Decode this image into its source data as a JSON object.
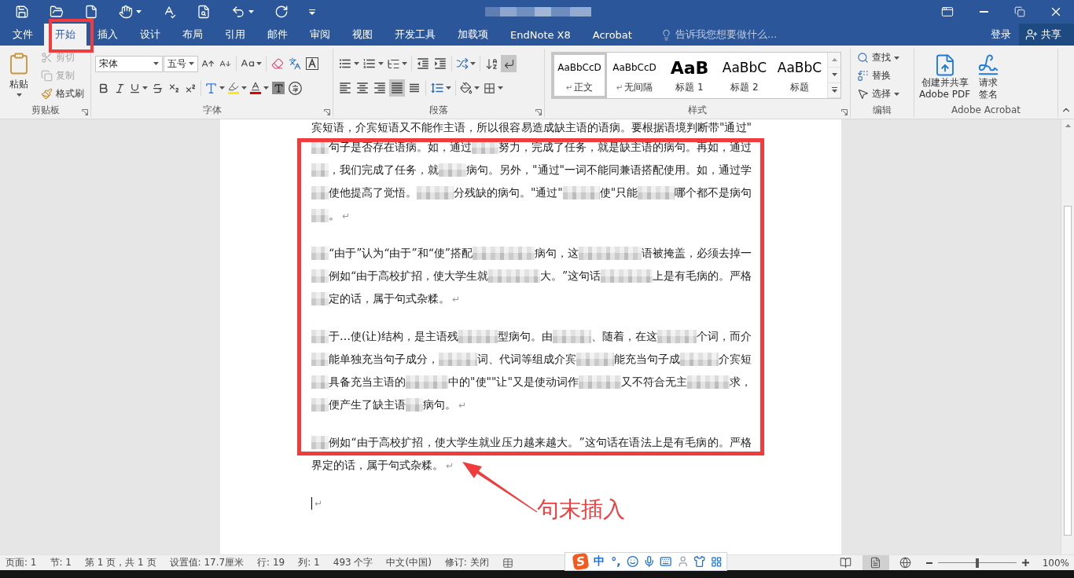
{
  "menu_tabs": [
    {
      "label": "文件",
      "selected": false
    },
    {
      "label": "开始",
      "selected": true
    },
    {
      "label": "插入",
      "selected": false
    },
    {
      "label": "设计",
      "selected": false
    },
    {
      "label": "布局",
      "selected": false
    },
    {
      "label": "引用",
      "selected": false
    },
    {
      "label": "邮件",
      "selected": false
    },
    {
      "label": "审阅",
      "selected": false
    },
    {
      "label": "视图",
      "selected": false
    },
    {
      "label": "开发工具",
      "selected": false
    },
    {
      "label": "加载项",
      "selected": false
    },
    {
      "label": "EndNote X8",
      "selected": false
    },
    {
      "label": "Acrobat",
      "selected": false
    }
  ],
  "tell_me": {
    "placeholder": "告诉我您想要做什么..."
  },
  "account": {
    "sign_in": "登录",
    "share": "共享"
  },
  "ribbon": {
    "clipboard": {
      "label": "剪贴板",
      "paste": "粘贴",
      "actions": [
        {
          "kind": "cut",
          "label": "剪切",
          "disabled": true
        },
        {
          "kind": "copy",
          "label": "复制",
          "disabled": true
        },
        {
          "kind": "format_painter",
          "label": "格式刷",
          "disabled": false
        }
      ]
    },
    "font": {
      "label": "字体",
      "font_name": "宋体",
      "font_size": "五号"
    },
    "paragraph": {
      "label": "段落",
      "show_marks": {
        "on": true
      },
      "alignment": [
        {
          "kind": "left",
          "selected": false
        },
        {
          "kind": "center",
          "selected": false
        },
        {
          "kind": "right",
          "selected": false
        },
        {
          "kind": "justify",
          "selected": true
        },
        {
          "kind": "distributed",
          "selected": false
        }
      ]
    },
    "styles": {
      "label": "样式",
      "items": [
        {
          "kind": "normal",
          "sample": "AaBbCcD",
          "mark": "↵",
          "name": "正文",
          "selected": true
        },
        {
          "kind": "normal",
          "sample": "AaBbCcD",
          "mark": "↵",
          "name": "无间隔",
          "selected": false
        },
        {
          "kind": "heading1",
          "sample": "AaB",
          "name": "标题 1",
          "selected": false
        },
        {
          "kind": "heading2",
          "sample": "AaBbC",
          "name": "标题 2",
          "selected": false
        },
        {
          "kind": "title",
          "sample": "AaBbC",
          "name": "标题",
          "selected": false
        }
      ]
    },
    "editing": {
      "label": "编辑",
      "actions": [
        {
          "kind": "find",
          "label": "查找"
        },
        {
          "kind": "replace",
          "label": "替换"
        },
        {
          "kind": "select",
          "label": "选择"
        }
      ]
    },
    "acrobat": {
      "label": "Adobe Acrobat",
      "actions": [
        {
          "kind": "create_pdf",
          "lines": [
            "创建并共享",
            "Adobe PDF"
          ]
        },
        {
          "kind": "sign",
          "lines": [
            "请求",
            "签名"
          ]
        }
      ]
    }
  },
  "document": {
    "paragraphs": [
      {
        "lines": [
          {
            "segments": [
              {
                "kind": "text",
                "text": "宾短语，介宾短语又不能作主语，所以很容易造成缺主语的语病。要根据语境判断带\"通过\""
              }
            ]
          },
          {
            "segments": [
              {
                "kind": "blur"
              },
              {
                "kind": "text",
                "text": "句子是否存在语病。如，通过"
              },
              {
                "kind": "blur"
              },
              {
                "kind": "text",
                "text": "努力，完成了任务，就是缺主语的病句。再如，通过"
              }
            ]
          },
          {
            "segments": [
              {
                "kind": "blur"
              },
              {
                "kind": "text",
                "text": "，我们完成了任务，就"
              },
              {
                "kind": "blur"
              },
              {
                "kind": "text",
                "text": "病句。另外，\"通过\"一词不能同兼语搭配使用。如，通过学"
              }
            ]
          },
          {
            "segments": [
              {
                "kind": "blur"
              },
              {
                "kind": "text",
                "text": "使他提高了觉悟。"
              },
              {
                "kind": "blur"
              },
              {
                "kind": "text",
                "text": "分残缺的病句。\"通过\""
              },
              {
                "kind": "blur"
              },
              {
                "kind": "text",
                "text": "使\"只能"
              },
              {
                "kind": "blur"
              },
              {
                "kind": "text",
                "text": "哪个都不是病句"
              }
            ]
          },
          {
            "segments": [
              {
                "kind": "blur"
              },
              {
                "kind": "text",
                "text": "。"
              },
              {
                "kind": "mark",
                "text": "↵"
              }
            ]
          }
        ]
      },
      {
        "lines": [
          {
            "segments": [
              {
                "kind": "blur"
              },
              {
                "kind": "text",
                "text": "“由于”认为“由于”和“使”搭配"
              },
              {
                "kind": "blur"
              },
              {
                "kind": "text",
                "text": "病句，这"
              },
              {
                "kind": "blur"
              },
              {
                "kind": "text",
                "text": "语被掩盖，必须去掉一"
              }
            ]
          },
          {
            "segments": [
              {
                "kind": "blur"
              },
              {
                "kind": "text",
                "text": "例如“由于高校扩招，使大学生就"
              },
              {
                "kind": "blur"
              },
              {
                "kind": "text",
                "text": "大。”这句话"
              },
              {
                "kind": "blur"
              },
              {
                "kind": "text",
                "text": "上是有毛病的。严格"
              }
            ]
          },
          {
            "segments": [
              {
                "kind": "blur"
              },
              {
                "kind": "text",
                "text": "定的话，属于句式杂糅。"
              },
              {
                "kind": "mark",
                "text": "↵"
              }
            ]
          }
        ]
      },
      {
        "lines": [
          {
            "segments": [
              {
                "kind": "blur"
              },
              {
                "kind": "text",
                "text": "于…使(让)结构，是主语残"
              },
              {
                "kind": "blur"
              },
              {
                "kind": "text",
                "text": "型病句。由"
              },
              {
                "kind": "blur"
              },
              {
                "kind": "text",
                "text": "、随着，在这"
              },
              {
                "kind": "blur"
              },
              {
                "kind": "text",
                "text": "个词，而介"
              }
            ]
          },
          {
            "segments": [
              {
                "kind": "blur"
              },
              {
                "kind": "text",
                "text": "能单独充当句子成分，"
              },
              {
                "kind": "blur"
              },
              {
                "kind": "text",
                "text": "词、代词等组成介宾"
              },
              {
                "kind": "blur"
              },
              {
                "kind": "text",
                "text": "能充当句子成"
              },
              {
                "kind": "blur"
              },
              {
                "kind": "text",
                "text": "介宾短"
              }
            ]
          },
          {
            "segments": [
              {
                "kind": "blur"
              },
              {
                "kind": "text",
                "text": "具备充当主语的"
              },
              {
                "kind": "blur"
              },
              {
                "kind": "text",
                "text": "中的\"使\"\"让\"又是使动词作"
              },
              {
                "kind": "blur"
              },
              {
                "kind": "text",
                "text": "又不符合无主"
              },
              {
                "kind": "blur"
              },
              {
                "kind": "text",
                "text": "求，"
              }
            ]
          },
          {
            "segments": [
              {
                "kind": "blur"
              },
              {
                "kind": "text",
                "text": "便产生了缺主语"
              },
              {
                "kind": "blur"
              },
              {
                "kind": "text",
                "text": "病句。"
              },
              {
                "kind": "mark",
                "text": "↵"
              }
            ]
          }
        ]
      },
      {
        "lines": [
          {
            "segments": [
              {
                "kind": "blur"
              },
              {
                "kind": "text",
                "text": "例如“由于高校扩招，使大学生就业压力越来越大。”这句话在语法上是有毛病的。严格"
              }
            ]
          },
          {
            "segments": [
              {
                "kind": "text",
                "text": "界定的话，属于句式杂糅。"
              },
              {
                "kind": "mark",
                "text": "↵"
              }
            ]
          }
        ]
      },
      {
        "lines": [
          {
            "segments": [
              {
                "kind": "cursor"
              },
              {
                "kind": "mark",
                "text": "↵"
              }
            ]
          }
        ]
      }
    ]
  },
  "annotation": {
    "label": "句末插入"
  },
  "status_bar": {
    "items": [
      "页面: 1",
      "节: 1",
      "第 1 页，共 1 页",
      "设置值: 17.7厘米",
      "行: 19",
      "列: 1",
      "493 个字",
      "中文(中国)",
      "修订: 关闭"
    ],
    "ime": {
      "logo": "S",
      "mode": "中",
      "punctuation": "°,"
    },
    "views": [
      {
        "kind": "read",
        "selected": false
      },
      {
        "kind": "print",
        "selected": true
      },
      {
        "kind": "web",
        "selected": false
      }
    ],
    "zoom": {
      "level": 0.5,
      "reading": "100%"
    }
  }
}
